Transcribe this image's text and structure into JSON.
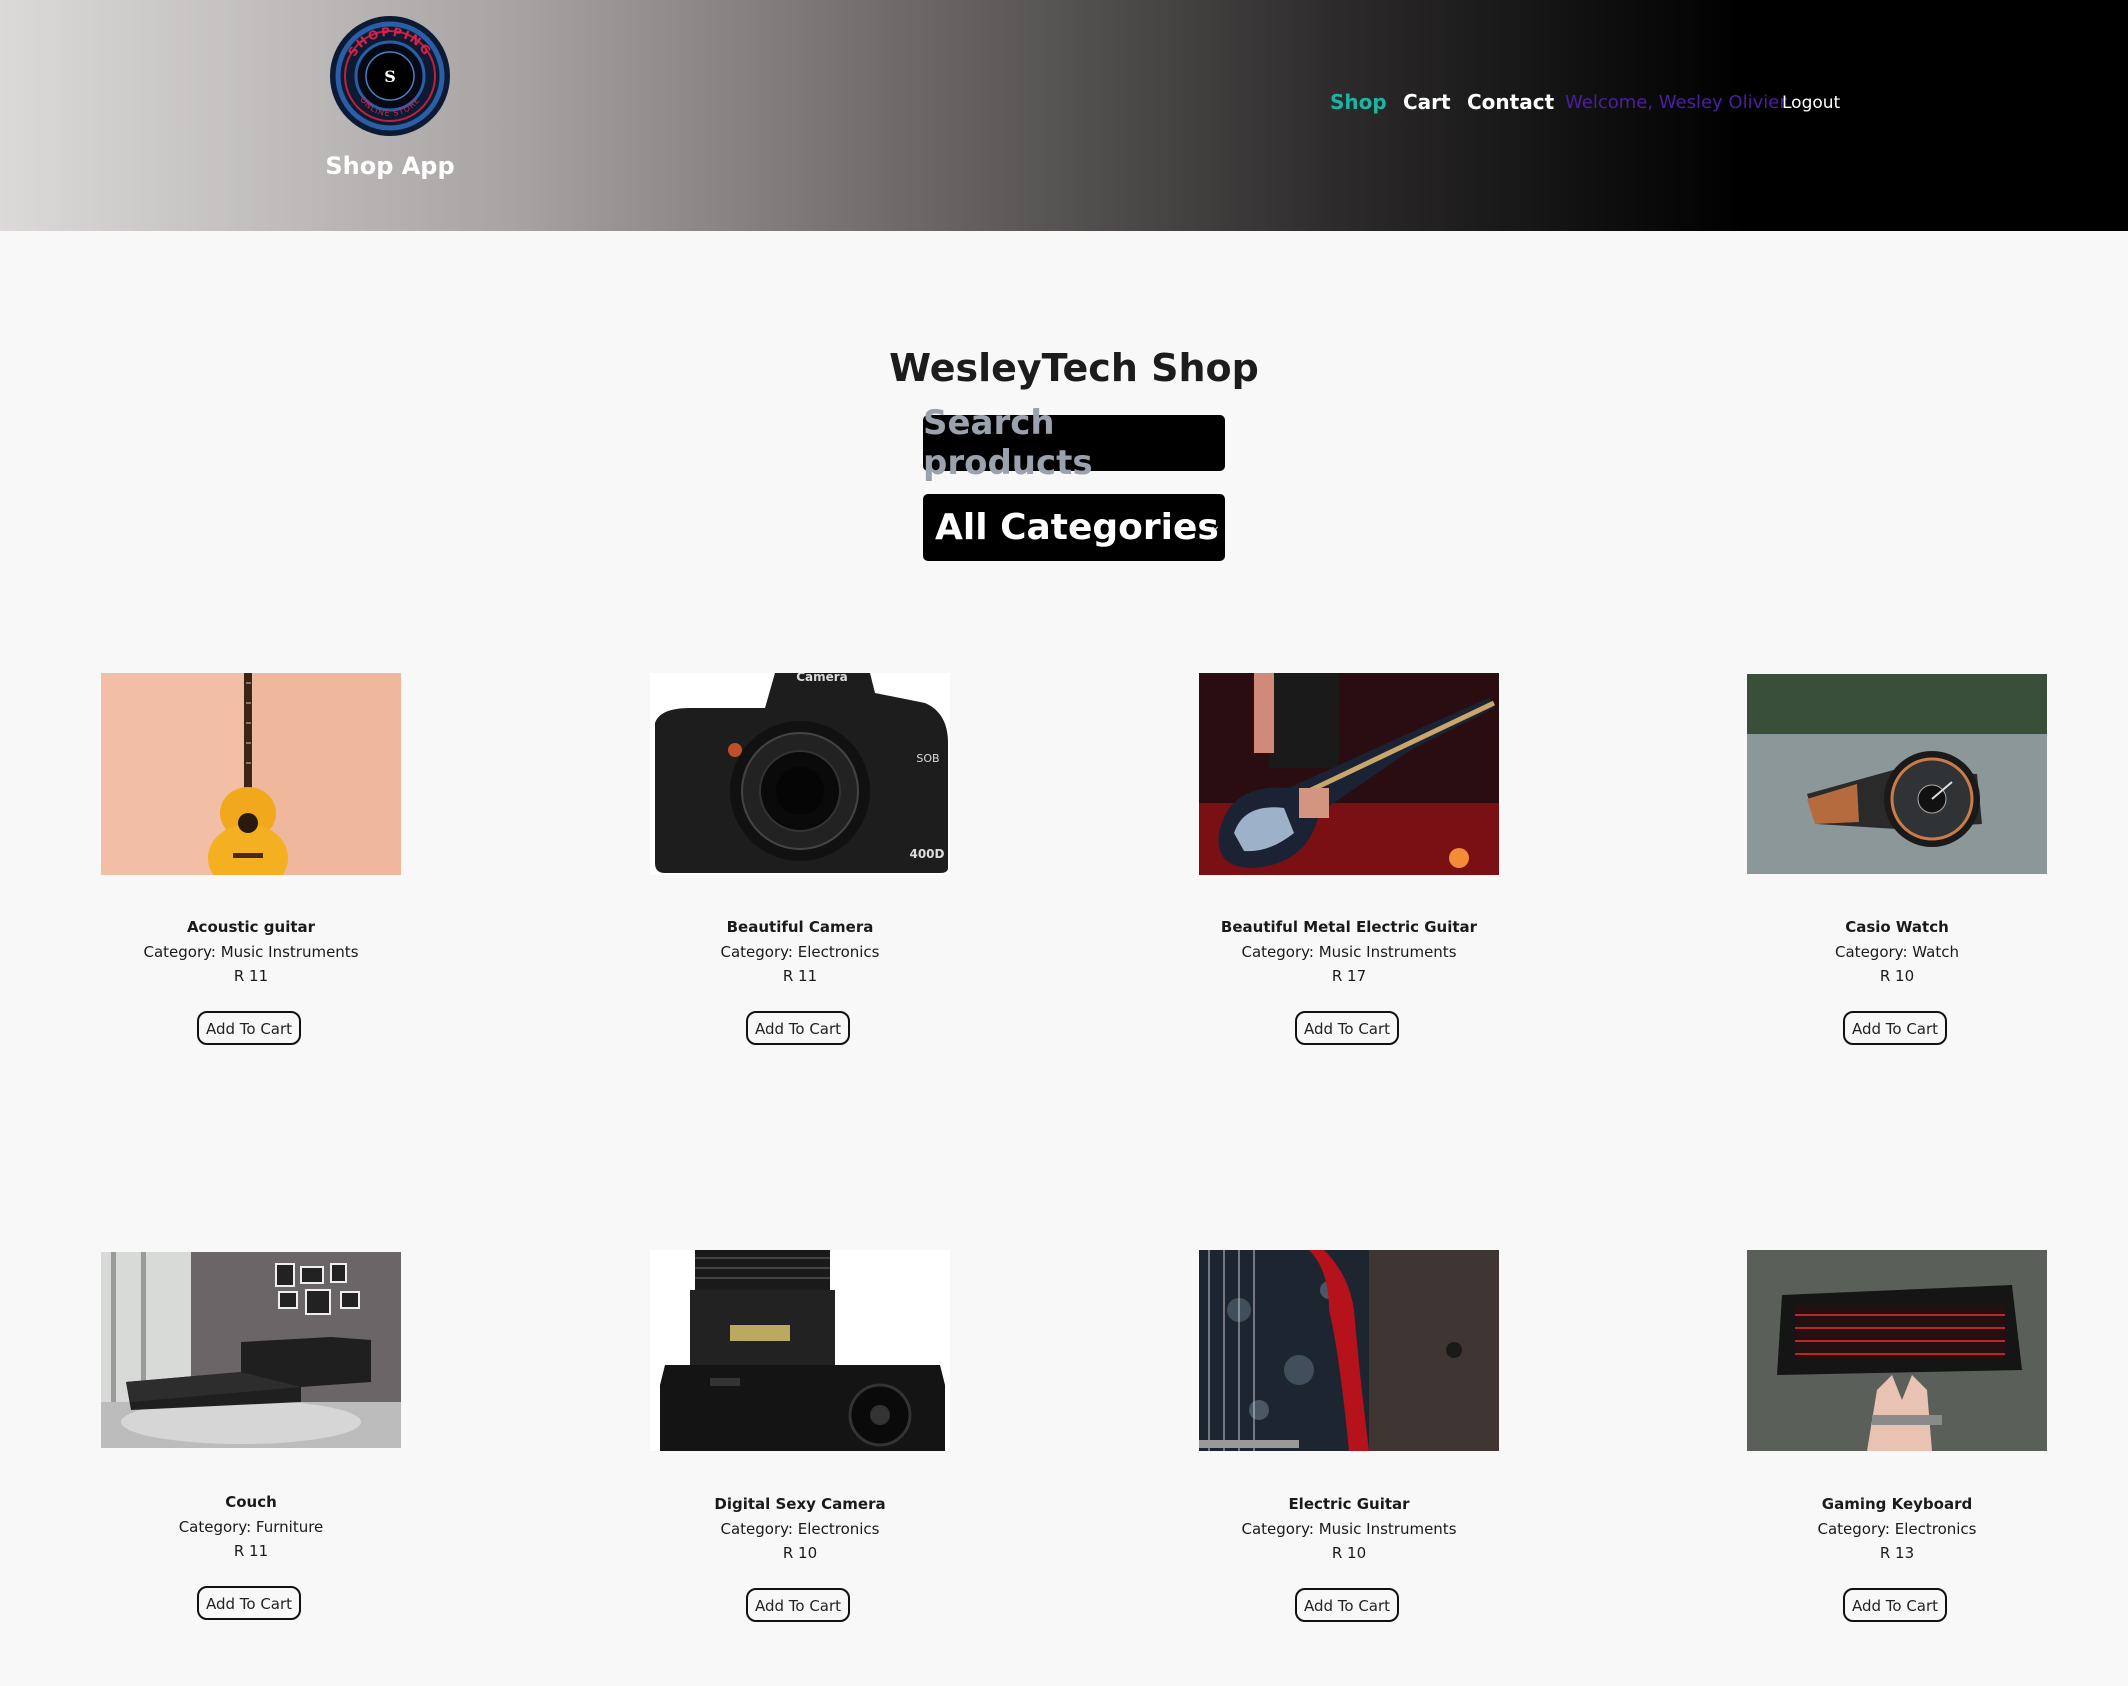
{
  "header": {
    "logo_text_top": "SHOPPING",
    "logo_text_bottom": "ONLINE STORE",
    "logo_letter": "S",
    "brand": "Shop App",
    "nav": {
      "shop": "Shop",
      "cart": "Cart",
      "contact": "Contact",
      "welcome": "Welcome, Wesley Olivier",
      "logout": "Logout"
    }
  },
  "main": {
    "title": "WesleyTech Shop",
    "search_placeholder": "Search products",
    "category_selected": "All Categories"
  },
  "products": [
    {
      "name": "Acoustic guitar",
      "category": "Category: Music Instruments",
      "price": "R 11",
      "button": "Add To Cart",
      "image_icon": "acoustic-guitar-image"
    },
    {
      "name": "Beautiful Camera",
      "category": "Category: Electronics",
      "price": "R 11",
      "button": "Add To Cart",
      "image_icon": "camera-image"
    },
    {
      "name": "Beautiful Metal Electric Guitar",
      "category": "Category: Music Instruments",
      "price": "R 17",
      "button": "Add To Cart",
      "image_icon": "electric-guitar-player-image"
    },
    {
      "name": "Casio Watch",
      "category": "Category: Watch",
      "price": "R 10",
      "button": "Add To Cart",
      "image_icon": "watch-image"
    },
    {
      "name": "Couch",
      "category": "Category: Furniture",
      "price": "R 11",
      "button": "Add To Cart",
      "image_icon": "couch-image"
    },
    {
      "name": "Digital Sexy Camera",
      "category": "Category: Electronics",
      "price": "R 10",
      "button": "Add To Cart",
      "image_icon": "camera-lens-image"
    },
    {
      "name": "Electric Guitar",
      "category": "Category: Music Instruments",
      "price": "R 10",
      "button": "Add To Cart",
      "image_icon": "guitar-closeup-image"
    },
    {
      "name": "Gaming Keyboard",
      "category": "Category: Electronics",
      "price": "R 13",
      "button": "Add To Cart",
      "image_icon": "keyboard-image"
    }
  ],
  "image_text": {
    "camera_label": "Camera",
    "camera_model": "400D",
    "camera_brand": "SOB"
  },
  "colors": {
    "nav_active": "#1eb3a3",
    "welcome": "#4b1fa0",
    "page_bg": "#f8f8f8"
  }
}
